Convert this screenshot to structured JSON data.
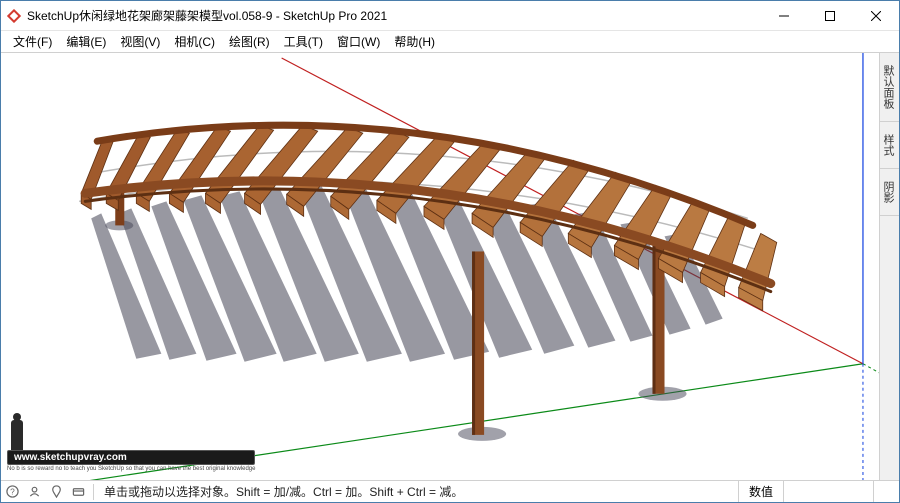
{
  "titlebar": {
    "title": "SketchUp休闲绿地花架廊架藤架模型vol.058-9 - SketchUp Pro 2021"
  },
  "menu": {
    "items": [
      "文件(F)",
      "编辑(E)",
      "视图(V)",
      "相机(C)",
      "绘图(R)",
      "工具(T)",
      "窗口(W)",
      "帮助(H)"
    ]
  },
  "side_tabs": [
    "默认面板",
    "样式",
    "阴影"
  ],
  "status": {
    "message": "单击或拖动以选择对象。Shift = 加/减。Ctrl = 加。Shift + Ctrl = 减。",
    "right_label": "数值"
  },
  "watermark": {
    "url": "www.sketchupvray.com",
    "tagline": "No b is so reward no to teach you SketchUp so that you can have the best original knowledge"
  }
}
